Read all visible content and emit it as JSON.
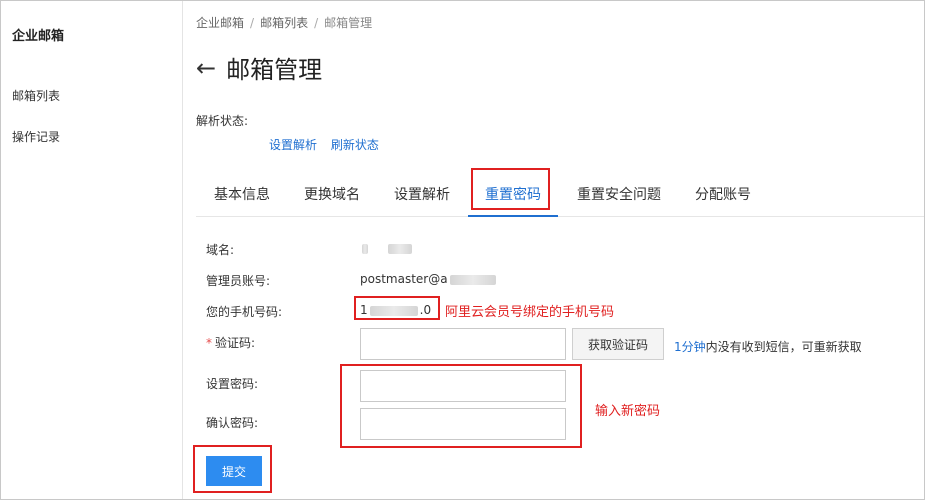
{
  "sidebar": {
    "app_title": "企业邮箱",
    "items": [
      {
        "label": "邮箱列表"
      },
      {
        "label": "操作记录"
      }
    ]
  },
  "breadcrumb": [
    "企业邮箱",
    "邮箱列表",
    "邮箱管理"
  ],
  "page": {
    "back_icon": "←",
    "title": "邮箱管理"
  },
  "dns": {
    "label": "解析状态:",
    "links": [
      "设置解析",
      "刷新状态"
    ]
  },
  "tabs": [
    {
      "label": "基本信息",
      "active": false
    },
    {
      "label": "更换域名",
      "active": false
    },
    {
      "label": "设置解析",
      "active": false
    },
    {
      "label": "重置密码",
      "active": true
    },
    {
      "label": "重置安全问题",
      "active": false
    },
    {
      "label": "分配账号",
      "active": false
    }
  ],
  "form": {
    "domain_label": "域名:",
    "admin_label": "管理员账号:",
    "admin_value_prefix": "postmaster@a",
    "phone_label": "您的手机号码:",
    "phone_value_prefix": "1",
    "phone_value_suffix": ".0",
    "code_label": "验证码:",
    "code_required_mark": "*",
    "code_value": "",
    "get_code_button": "获取验证码",
    "sms_hint_blue": "1分钟",
    "sms_hint_rest": "内没有收到短信，可重新获取",
    "new_password_label": "设置密码:",
    "new_password_value": "",
    "confirm_password_label": "确认密码:",
    "confirm_password_value": "",
    "submit_button": "提交"
  },
  "annotations": {
    "phone_note": "阿里云会员号绑定的手机号码",
    "password_note": "输入新密码"
  },
  "colors": {
    "accent": "#1f6fd0",
    "primary_button": "#2d8cf0",
    "highlight": "#e02020"
  }
}
